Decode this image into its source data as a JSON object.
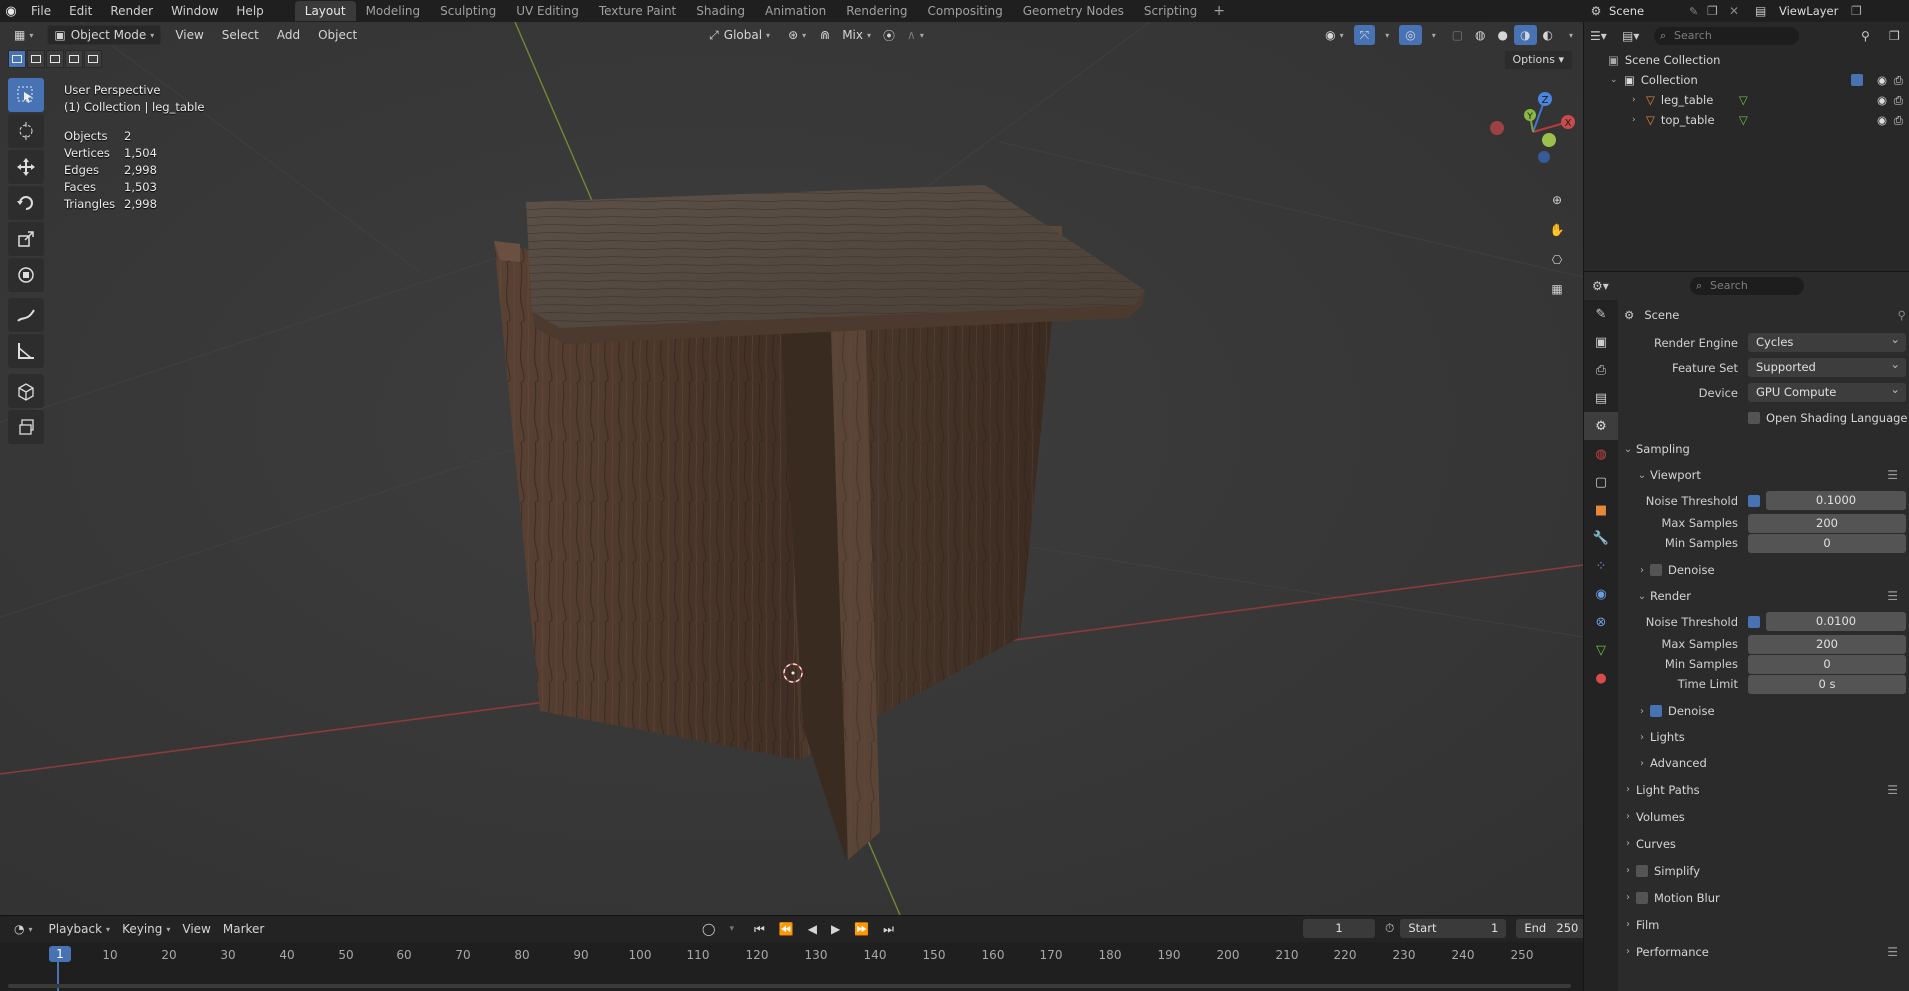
{
  "menu": [
    "File",
    "Edit",
    "Render",
    "Window",
    "Help"
  ],
  "workspaces": [
    "Layout",
    "Modeling",
    "Sculpting",
    "UV Editing",
    "Texture Paint",
    "Shading",
    "Animation",
    "Rendering",
    "Compositing",
    "Geometry Nodes",
    "Scripting"
  ],
  "workspace_add": "+",
  "scene": {
    "label": "Scene",
    "viewlayer": "ViewLayer"
  },
  "viewport": {
    "mode": "Object Mode",
    "menus": [
      "View",
      "Select",
      "Add",
      "Object"
    ],
    "transform_orientation": "Global",
    "snap_mode": "Mix",
    "options_label": "Options",
    "perspective": "User Perspective",
    "context": "(1) Collection | leg_table",
    "stats": [
      {
        "label": "Objects",
        "value": "2"
      },
      {
        "label": "Vertices",
        "value": "1,504"
      },
      {
        "label": "Edges",
        "value": "2,998"
      },
      {
        "label": "Faces",
        "value": "1,503"
      },
      {
        "label": "Triangles",
        "value": "2,998"
      }
    ],
    "gizmo_axes": {
      "x": "X",
      "y": "Y",
      "z": "Z"
    },
    "colors": {
      "x_axis": "#b83c3c",
      "y_axis": "#7ba33a",
      "z_axis": "#3d78d0",
      "accent": "#4772b3"
    }
  },
  "timeline": {
    "menus": [
      "Playback",
      "Keying",
      "View",
      "Marker"
    ],
    "current_frame": "1",
    "start_label": "Start",
    "start": "1",
    "end_label": "End",
    "end": "250",
    "ticks": [
      "10",
      "20",
      "30",
      "40",
      "50",
      "60",
      "70",
      "80",
      "90",
      "100",
      "110",
      "120",
      "130",
      "140",
      "150",
      "160",
      "170",
      "180",
      "190",
      "200",
      "210",
      "220",
      "230",
      "240",
      "250"
    ]
  },
  "outliner": {
    "search_placeholder": "Search",
    "scene_collection": "Scene Collection",
    "collection": "Collection",
    "objects": [
      "leg_table",
      "top_table"
    ]
  },
  "properties": {
    "search_placeholder": "Search",
    "context": "Scene",
    "render_engine_label": "Render Engine",
    "render_engine": "Cycles",
    "feature_set_label": "Feature Set",
    "feature_set": "Supported",
    "device_label": "Device",
    "device": "GPU Compute",
    "osl_label": "Open Shading Language",
    "sampling": "Sampling",
    "viewport_section": "Viewport",
    "noise_threshold_label": "Noise Threshold",
    "viewport_noise": "0.1000",
    "max_samples_label": "Max Samples",
    "viewport_max": "200",
    "min_samples_label": "Min Samples",
    "viewport_min": "0",
    "denoise_label": "Denoise",
    "render_section": "Render",
    "render_noise": "0.0100",
    "render_max": "200",
    "render_min": "0",
    "time_limit_label": "Time Limit",
    "time_limit": "0 s",
    "lights": "Lights",
    "advanced": "Advanced",
    "panels": [
      "Light Paths",
      "Volumes",
      "Curves",
      "Simplify",
      "Motion Blur",
      "Film",
      "Performance"
    ]
  }
}
